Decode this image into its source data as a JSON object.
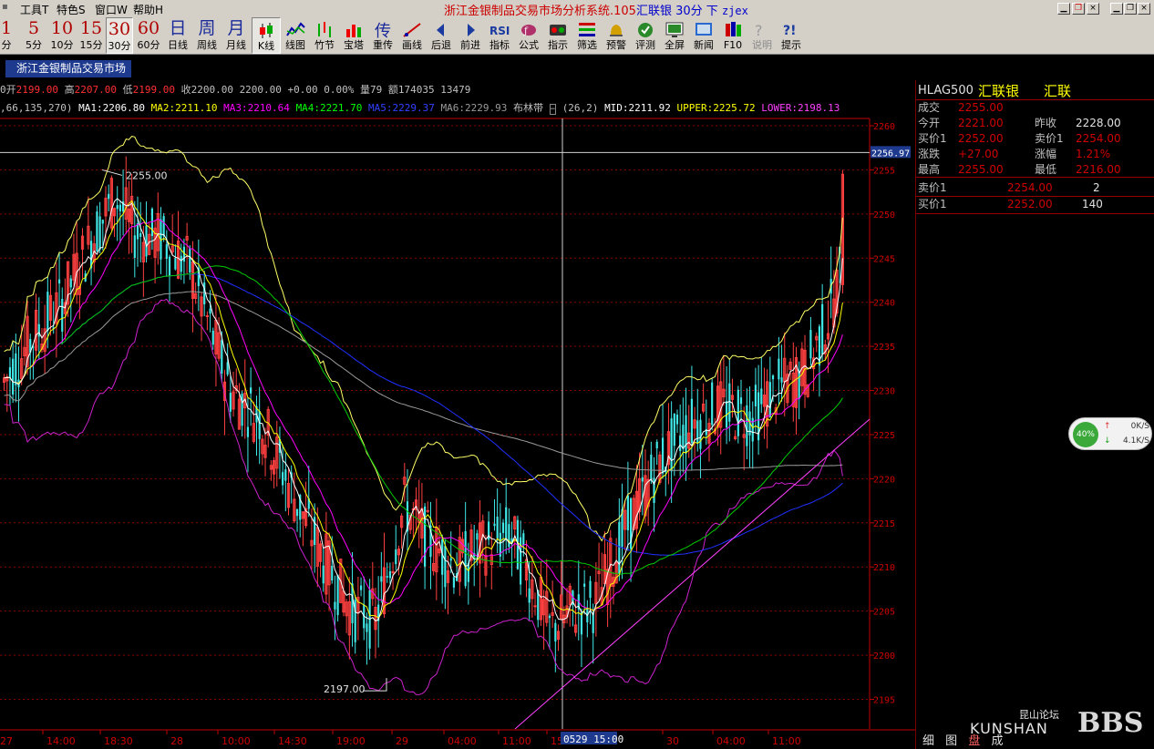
{
  "menubar": {
    "items": [
      "工具T",
      "特色S",
      "窗口W",
      "帮助H"
    ],
    "title_main": "浙江金银制品交易市场分析系统.105",
    "title_symbol": "汇联银",
    "title_period": "30分",
    "title_dir": "下",
    "title_user": "zjex"
  },
  "periods": [
    {
      "n": "1",
      "l": "分"
    },
    {
      "n": "5",
      "l": "5分"
    },
    {
      "n": "10",
      "l": "10分"
    },
    {
      "n": "15",
      "l": "15分"
    },
    {
      "n": "30",
      "l": "30分"
    },
    {
      "n": "60",
      "l": "60分"
    },
    {
      "n": "日",
      "l": "日线"
    },
    {
      "n": "周",
      "l": "周线"
    },
    {
      "n": "月",
      "l": "月线"
    }
  ],
  "tools": [
    {
      "l": "K线",
      "icon": "candlestick-icon"
    },
    {
      "l": "线图",
      "icon": "line-chart-icon"
    },
    {
      "l": "竹节",
      "icon": "bamboo-chart-icon"
    },
    {
      "l": "宝塔",
      "icon": "tower-chart-icon"
    },
    {
      "l": "重传",
      "icon": "retransmit-icon"
    },
    {
      "l": "画线",
      "icon": "draw-line-icon"
    },
    {
      "l": "后退",
      "icon": "back-arrow-icon"
    },
    {
      "l": "前进",
      "icon": "forward-arrow-icon"
    },
    {
      "l": "指标",
      "icon": "rsi-indicator-icon"
    },
    {
      "l": "公式",
      "icon": "formula-icon"
    },
    {
      "l": "指示",
      "icon": "indicator-icon"
    },
    {
      "l": "筛选",
      "icon": "filter-icon"
    },
    {
      "l": "预警",
      "icon": "alert-bell-icon"
    },
    {
      "l": "评测",
      "icon": "evaluate-icon"
    },
    {
      "l": "全屏",
      "icon": "fullscreen-icon"
    },
    {
      "l": "新闻",
      "icon": "news-icon"
    },
    {
      "l": "F10",
      "icon": "f10-books-icon"
    },
    {
      "l": "说明",
      "icon": "help-disabled-icon"
    },
    {
      "l": "提示",
      "icon": "tips-icon"
    }
  ],
  "market_tab": "浙江金银制品交易市场",
  "quote_line": {
    "open_label": "0开",
    "open": "2199.00",
    "high_label": "高",
    "high": "2207.00",
    "low_label": "低",
    "low": "2199.00",
    "close_label": "收",
    "close": "2200.00",
    "close2": "2200.00",
    "change": "+0.00",
    "pct": "0.00%",
    "vol_label": "量",
    "vol": "79",
    "amt_label": "额",
    "amt": "174035",
    "oi": "13479"
  },
  "ma_line": {
    "params": ",66,135,270)",
    "ma1": "MA1:2206.80",
    "ma2": "MA2:2211.10",
    "ma3": "MA3:2210.64",
    "ma4": "MA4:2221.70",
    "ma5": "MA5:2229.37",
    "ma6": "MA6:2229.93",
    "boll_name": "布林带",
    "boll_params": "(26,2)",
    "mid": "MID:2211.92",
    "upper": "UPPER:2225.72",
    "lower": "LOWER:2198.13"
  },
  "chart_data": {
    "type": "candlestick",
    "ylim": [
      2193,
      2261
    ],
    "y_ticks": [
      2260,
      2255,
      2250,
      2245,
      2240,
      2235,
      2230,
      2225,
      2220,
      2215,
      2210,
      2205,
      2200,
      2195
    ],
    "x_ticks": [
      "27",
      "14:00",
      "18:30",
      "28",
      "10:00",
      "14:30",
      "19:00",
      "29",
      "04:00",
      "11:00",
      "15",
      "0529 15:00",
      "30",
      "04:00",
      "11:00"
    ],
    "annotations": [
      {
        "text": "2255.00",
        "value": 2255
      },
      {
        "text": "2197.00",
        "value": 2197
      }
    ],
    "current_price_label": "2256.97",
    "current_price": 2256.97,
    "ma_colors": {
      "ma1": "#ffffff",
      "ma2": "#ffff00",
      "ma3": "#ff00ff",
      "ma4": "#00cc00",
      "ma5": "#2030ff",
      "ma6": "#9a9a9a",
      "upper": "#ffff66",
      "lower": "#cc22cc",
      "mid": "#ffffff",
      "trendline": "#ff40ff"
    },
    "candles": []
  },
  "panel": {
    "code": "HLAG500",
    "name": "汇联银",
    "short": "汇联",
    "rows": [
      {
        "l": "成交",
        "v": "2255.00"
      },
      {
        "l": "今开",
        "v": "2221.00",
        "l2": "昨收",
        "v2": "2228.00"
      },
      {
        "l": "买价1",
        "v": "2252.00",
        "l2": "卖价1",
        "v2": "2254.00"
      },
      {
        "l": "涨跌",
        "v": "+27.00",
        "l2": "涨幅",
        "v2": "1.21%"
      },
      {
        "l": "最高",
        "v": "2255.00",
        "l2": "最低",
        "v2": "2216.00"
      }
    ],
    "sell_label": "卖价1",
    "sell_price": "2254.00",
    "sell_qty": "2",
    "buy_label": "买价1",
    "buy_price": "2252.00",
    "buy_qty": "140"
  },
  "widget": {
    "pct": "40%",
    "up": "0K/S",
    "down": "4.1K/S"
  },
  "watermark": {
    "cn": "昆山论坛",
    "en": "KUNSHAN",
    "bbs": "BBS"
  },
  "bottom_tabs": [
    "细",
    "图",
    "盘",
    "成"
  ]
}
